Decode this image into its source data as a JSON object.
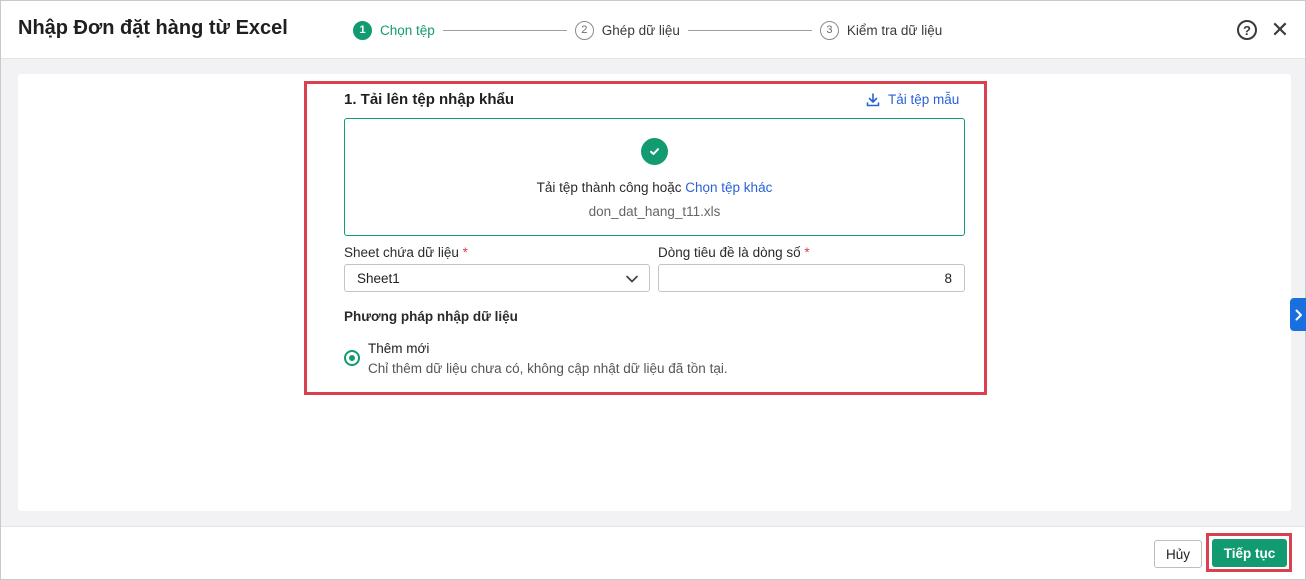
{
  "dialog": {
    "title": "Nhập Đơn đặt hàng từ Excel",
    "help_glyph": "?",
    "close_glyph": "✕"
  },
  "steps": [
    {
      "num": "1",
      "label": "Chọn tệp",
      "active": true
    },
    {
      "num": "2",
      "label": "Ghép dữ liệu",
      "active": false
    },
    {
      "num": "3",
      "label": "Kiểm tra dữ liệu",
      "active": false
    }
  ],
  "upload": {
    "section_title": "1. Tải lên tệp nhập khẩu",
    "download_template": "Tải tệp mẫu",
    "success_text": "Tải tệp thành công hoặc ",
    "choose_other": "Chọn tệp khác",
    "file_name": "don_dat_hang_t11.xls"
  },
  "fields": {
    "sheet_label": "Sheet chứa dữ liệu",
    "sheet_value": "Sheet1",
    "header_row_label": "Dòng tiêu đề là dòng số",
    "header_row_value": "8",
    "required_mark": "*"
  },
  "method": {
    "title": "Phương pháp nhập dữ liệu",
    "option_label": "Thêm mới",
    "option_desc": "Chỉ thêm dữ liệu chưa có, không cập nhật dữ liệu đã tồn tại."
  },
  "footer": {
    "cancel_label": "Hủy",
    "next_label": "Tiếp tục"
  },
  "colors": {
    "accent": "#129a70",
    "link": "#2962d6",
    "highlight": "#d9414e",
    "side_tab": "#1a6fe0"
  },
  "icons": {
    "download": "download-icon",
    "check": "check-icon",
    "chevron": "chevron-down-icon",
    "side": "chevron-right-icon"
  }
}
